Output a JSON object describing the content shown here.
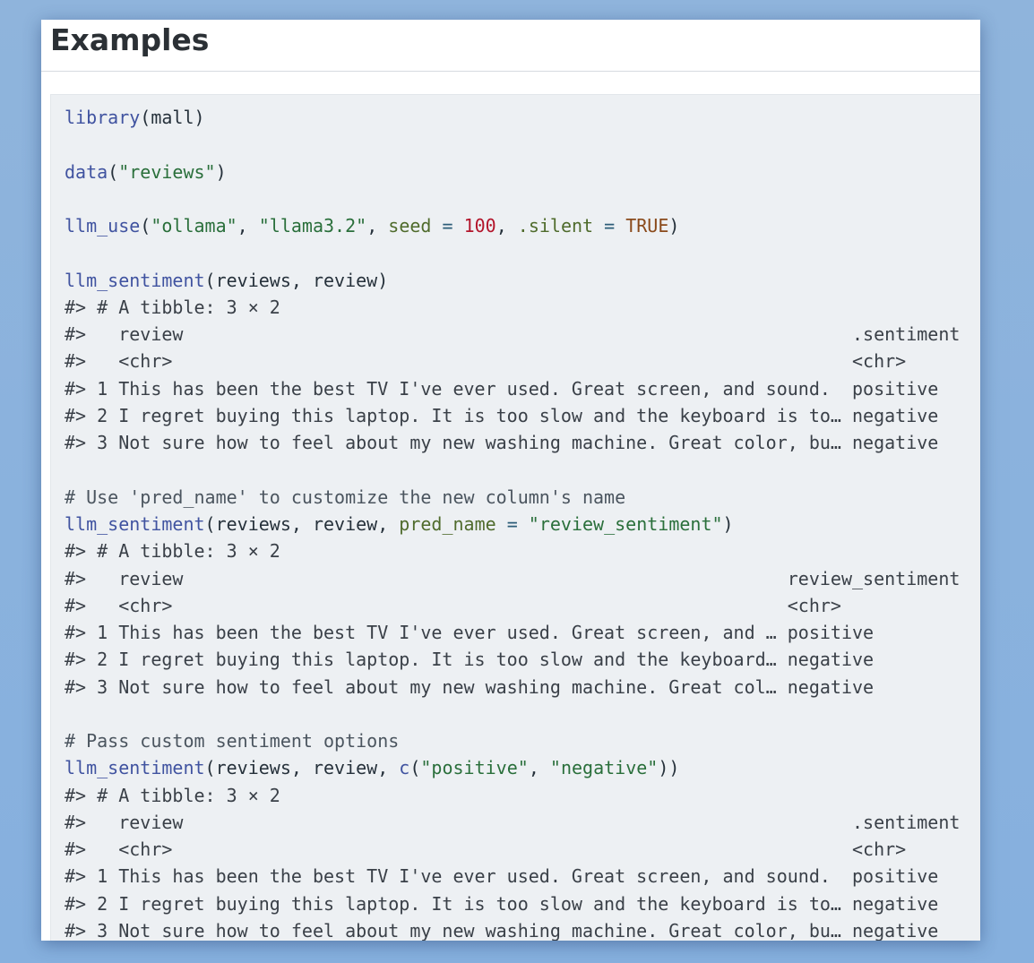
{
  "page": {
    "title": "Examples"
  },
  "code": {
    "lines": [
      [
        {
          "t": "library",
          "c": "fn"
        },
        {
          "t": "(mall)",
          "c": "plain"
        }
      ],
      [],
      [
        {
          "t": "data",
          "c": "fn"
        },
        {
          "t": "(",
          "c": "plain"
        },
        {
          "t": "\"reviews\"",
          "c": "str"
        },
        {
          "t": ")",
          "c": "plain"
        }
      ],
      [],
      [
        {
          "t": "llm_use",
          "c": "fn"
        },
        {
          "t": "(",
          "c": "plain"
        },
        {
          "t": "\"ollama\"",
          "c": "str"
        },
        {
          "t": ", ",
          "c": "plain"
        },
        {
          "t": "\"llama3.2\"",
          "c": "str"
        },
        {
          "t": ", ",
          "c": "plain"
        },
        {
          "t": "seed",
          "c": "arg"
        },
        {
          "t": " = ",
          "c": "op"
        },
        {
          "t": "100",
          "c": "num"
        },
        {
          "t": ", ",
          "c": "plain"
        },
        {
          "t": ".silent",
          "c": "arg"
        },
        {
          "t": " = ",
          "c": "op"
        },
        {
          "t": "TRUE",
          "c": "const"
        },
        {
          "t": ")",
          "c": "plain"
        }
      ],
      [],
      [
        {
          "t": "llm_sentiment",
          "c": "fn"
        },
        {
          "t": "(reviews, review)",
          "c": "plain"
        }
      ],
      [
        {
          "t": "#> # A tibble: 3 × 2",
          "c": "out"
        }
      ],
      [
        {
          "t": "#>   review                                                              .sentiment",
          "c": "out"
        }
      ],
      [
        {
          "t": "#>   <chr>                                                               <chr>",
          "c": "out"
        }
      ],
      [
        {
          "t": "#> 1 This has been the best TV I've ever used. Great screen, and sound.  positive",
          "c": "out"
        }
      ],
      [
        {
          "t": "#> 2 I regret buying this laptop. It is too slow and the keyboard is to… negative",
          "c": "out"
        }
      ],
      [
        {
          "t": "#> 3 Not sure how to feel about my new washing machine. Great color, bu… negative",
          "c": "out"
        }
      ],
      [],
      [
        {
          "t": "# Use 'pred_name' to customize the new column's name",
          "c": "com"
        }
      ],
      [
        {
          "t": "llm_sentiment",
          "c": "fn"
        },
        {
          "t": "(reviews, review, ",
          "c": "plain"
        },
        {
          "t": "pred_name",
          "c": "arg"
        },
        {
          "t": " = ",
          "c": "op"
        },
        {
          "t": "\"review_sentiment\"",
          "c": "str"
        },
        {
          "t": ")",
          "c": "plain"
        }
      ],
      [
        {
          "t": "#> # A tibble: 3 × 2",
          "c": "out"
        }
      ],
      [
        {
          "t": "#>   review                                                        review_sentiment",
          "c": "out"
        }
      ],
      [
        {
          "t": "#>   <chr>                                                         <chr>",
          "c": "out"
        }
      ],
      [
        {
          "t": "#> 1 This has been the best TV I've ever used. Great screen, and … positive",
          "c": "out"
        }
      ],
      [
        {
          "t": "#> 2 I regret buying this laptop. It is too slow and the keyboard… negative",
          "c": "out"
        }
      ],
      [
        {
          "t": "#> 3 Not sure how to feel about my new washing machine. Great col… negative",
          "c": "out"
        }
      ],
      [],
      [
        {
          "t": "# Pass custom sentiment options",
          "c": "com"
        }
      ],
      [
        {
          "t": "llm_sentiment",
          "c": "fn"
        },
        {
          "t": "(reviews, review, ",
          "c": "plain"
        },
        {
          "t": "c",
          "c": "fn"
        },
        {
          "t": "(",
          "c": "plain"
        },
        {
          "t": "\"positive\"",
          "c": "str"
        },
        {
          "t": ", ",
          "c": "plain"
        },
        {
          "t": "\"negative\"",
          "c": "str"
        },
        {
          "t": "))",
          "c": "plain"
        }
      ],
      [
        {
          "t": "#> # A tibble: 3 × 2",
          "c": "out"
        }
      ],
      [
        {
          "t": "#>   review                                                              .sentiment",
          "c": "out"
        }
      ],
      [
        {
          "t": "#>   <chr>                                                               <chr>",
          "c": "out"
        }
      ],
      [
        {
          "t": "#> 1 This has been the best TV I've ever used. Great screen, and sound.  positive",
          "c": "out"
        }
      ],
      [
        {
          "t": "#> 2 I regret buying this laptop. It is too slow and the keyboard is to… negative",
          "c": "out"
        }
      ],
      [
        {
          "t": "#> 3 Not sure how to feel about my new washing machine. Great color, bu… negative",
          "c": "out"
        }
      ]
    ]
  }
}
